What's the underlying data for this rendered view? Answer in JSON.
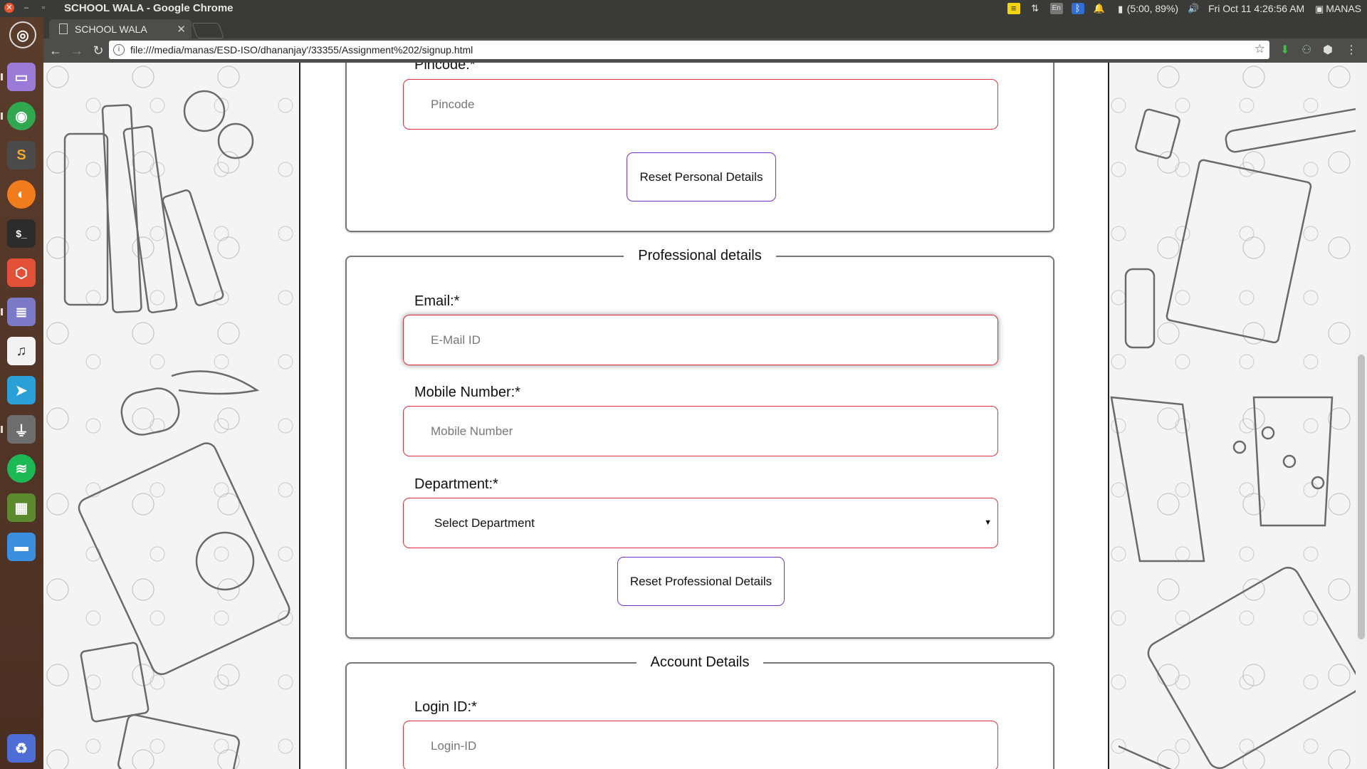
{
  "window": {
    "title": "SCHOOL WALA - Google Chrome",
    "tray": {
      "language": "En",
      "battery": "(5:00, 89%)",
      "datetime": "Fri Oct 11  4:26:56 AM",
      "user": "MANAS"
    }
  },
  "launcher": {
    "apps": [
      "ubuntu-dash-icon",
      "files-icon",
      "chrome-icon",
      "sublime-icon",
      "firefox-icon",
      "terminal-icon",
      "app-center-icon",
      "text-editor-icon",
      "music-icon",
      "telegram-icon",
      "usb-icon",
      "spotify-icon",
      "minecraft-icon",
      "folder-icon",
      "trash-icon"
    ]
  },
  "browser": {
    "tab_title": "SCHOOL WALA",
    "url": "file:///media/manas/ESD-ISO/dhananjay'/33355/Assignment%202/signup.html"
  },
  "form": {
    "personal": {
      "pincode_label": "Pincode:*",
      "pincode_placeholder": "Pincode",
      "reset_label": "Reset Personal Details"
    },
    "professional": {
      "legend": "Professional details",
      "email_label": "Email:*",
      "email_placeholder": "E-Mail ID",
      "mobile_label": "Mobile Number:*",
      "mobile_placeholder": "Mobile Number",
      "department_label": "Department:*",
      "department_selected": "Select Department",
      "reset_label": "Reset Professional Details"
    },
    "account": {
      "legend": "Account Details",
      "login_label": "Login ID:*",
      "login_placeholder": "Login-ID"
    }
  },
  "colors": {
    "field_border": "#e0303a",
    "button_border": "#7a2fd0",
    "launcher_bg": "#5a3c2b",
    "panel_bg": "#3a3a38"
  }
}
